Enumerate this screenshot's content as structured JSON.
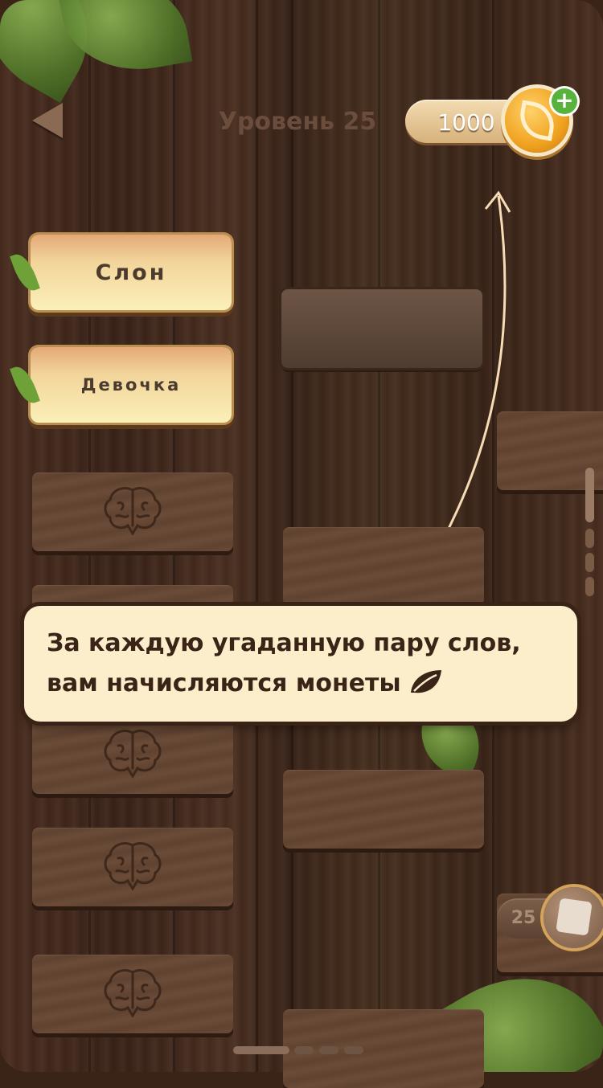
{
  "header": {
    "level_title": "Уровень 25",
    "coins": "1000",
    "add_coins_symbol": "+"
  },
  "left_column": {
    "cards": [
      {
        "label": "Слон",
        "state": "revealed"
      },
      {
        "label": "Девочка",
        "state": "revealed"
      },
      {
        "state": "hidden"
      },
      {
        "state": "hidden"
      },
      {
        "state": "hidden"
      },
      {
        "state": "hidden"
      },
      {
        "state": "hidden"
      }
    ]
  },
  "tutorial": {
    "message": "За каждую угаданную пару слов, вам начисляются монеты"
  },
  "hint": {
    "count": "25"
  },
  "icons": {
    "back": "back-arrow-icon",
    "coin": "coin-leaf-icon",
    "hidden_card": "brain-icon",
    "hint": "dice-icon"
  },
  "colors": {
    "accent": "#f0a21f",
    "card_text": "#4b3a2e",
    "callout_bg": "#fcedcb",
    "add_badge": "#57b33b"
  }
}
